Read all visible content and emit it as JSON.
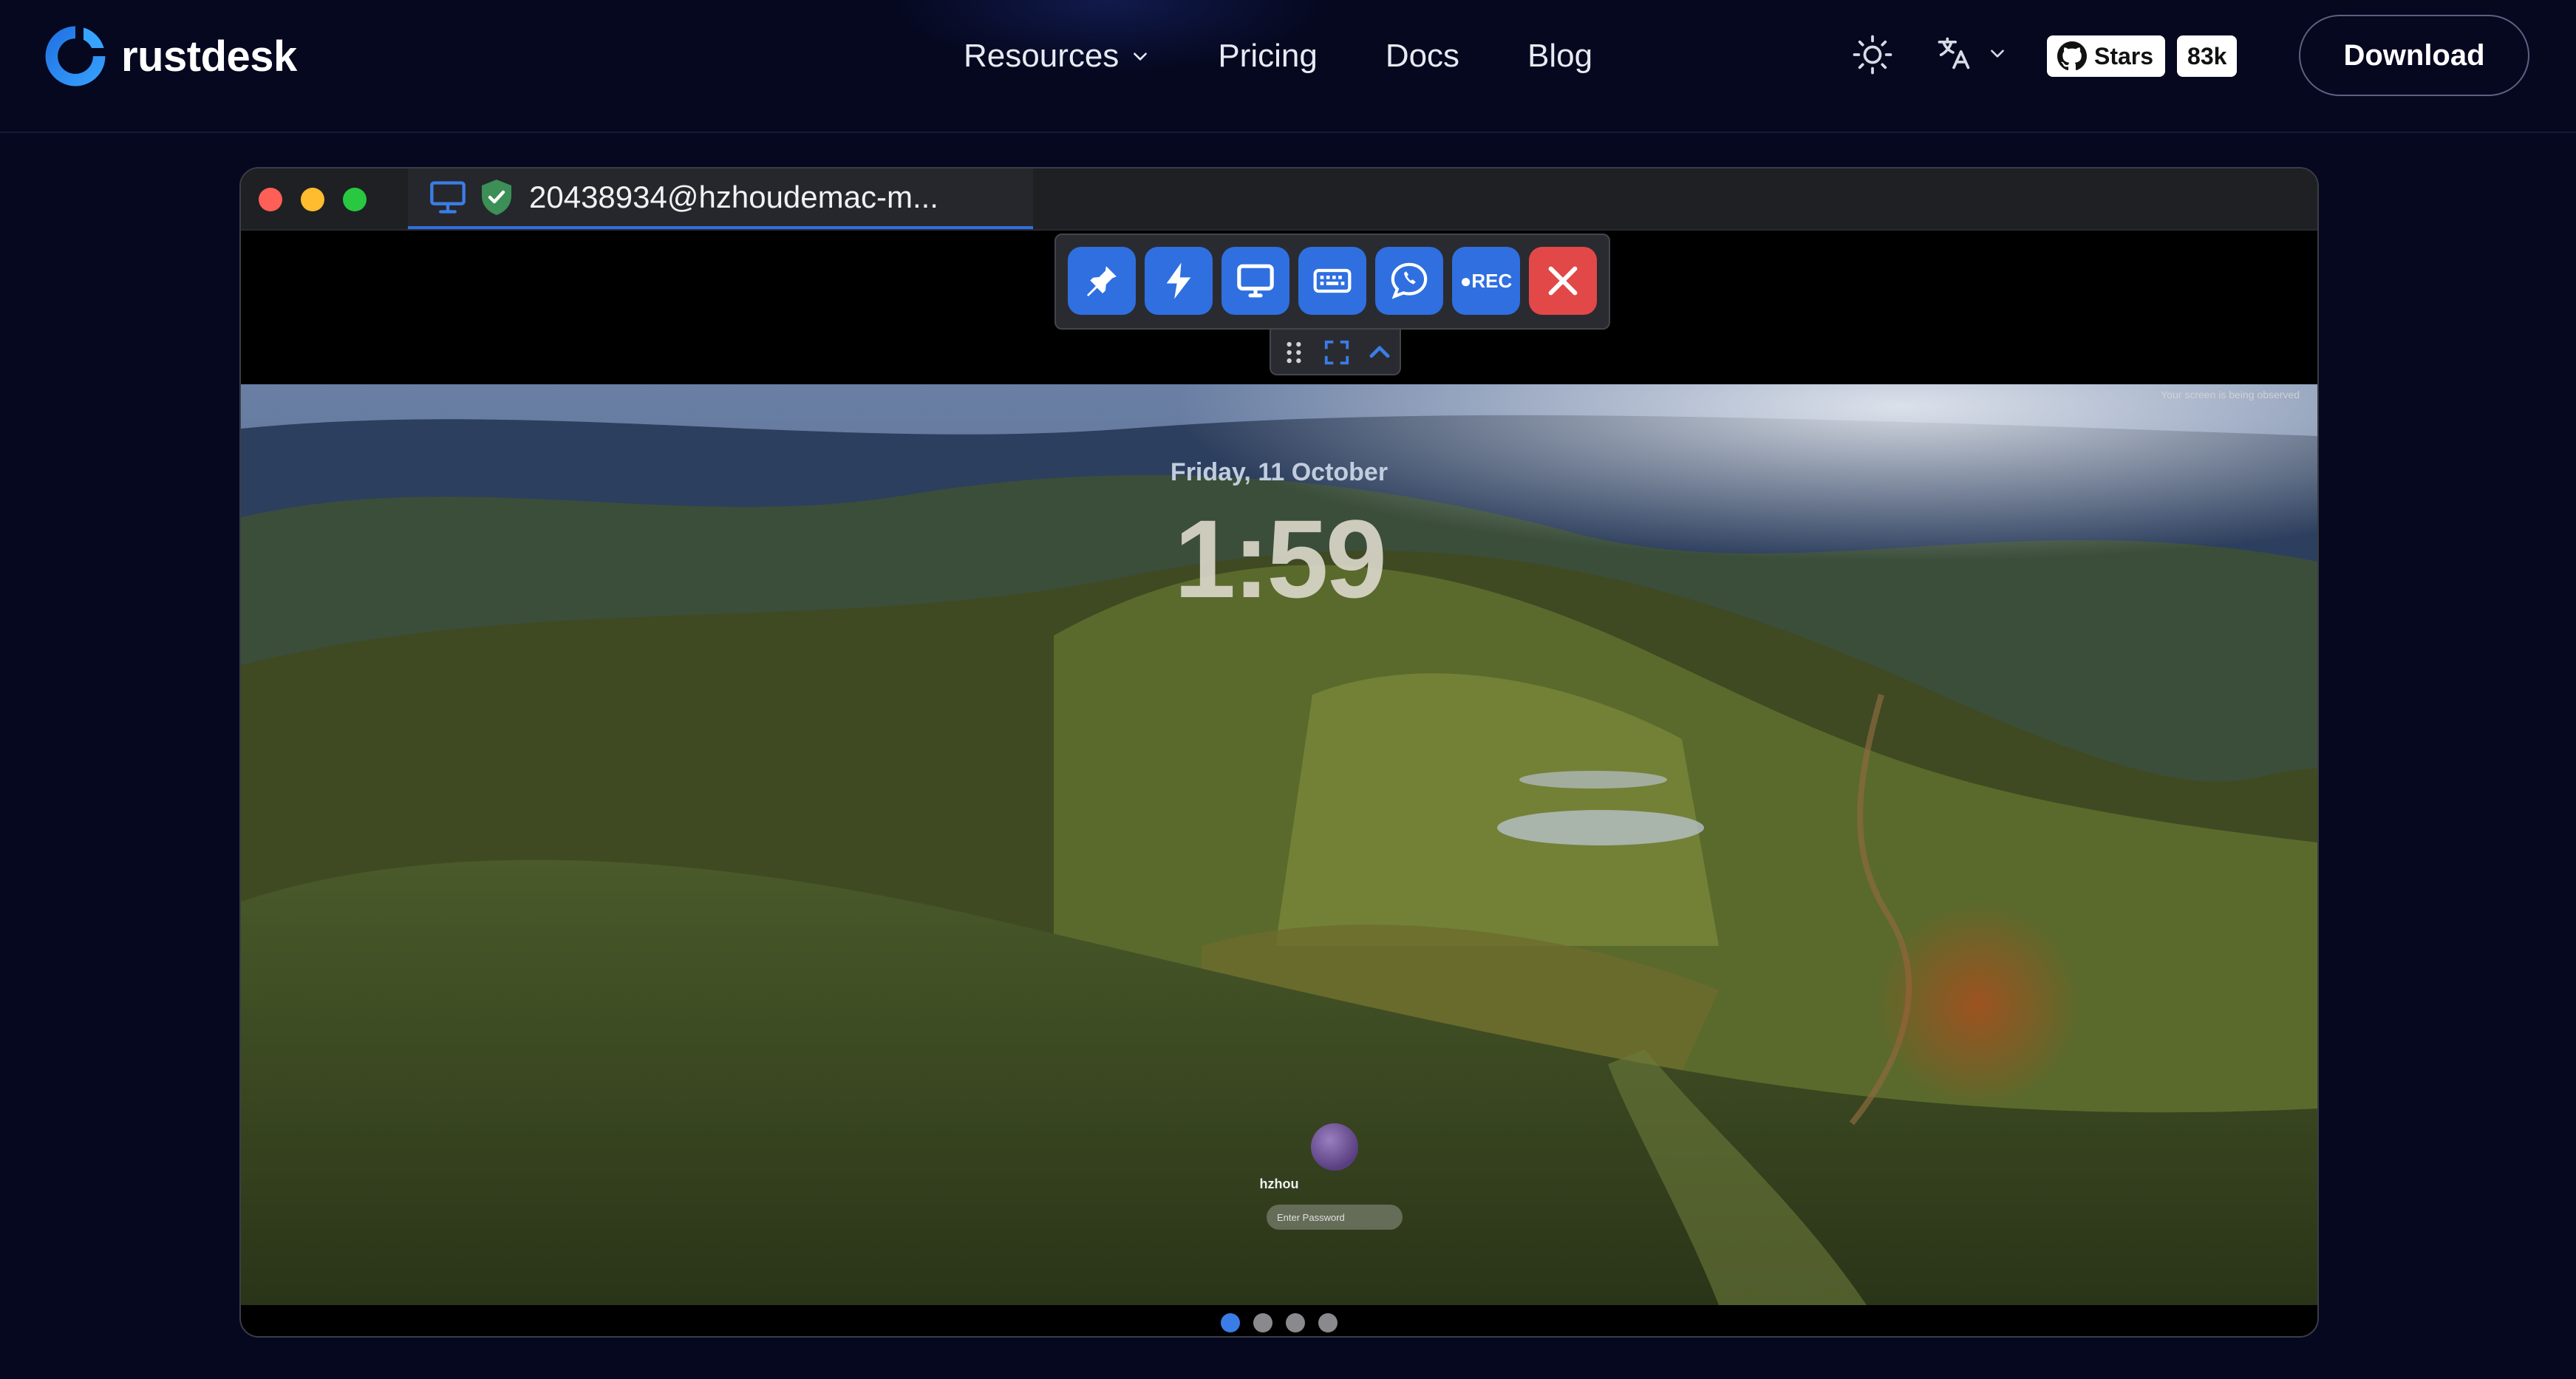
{
  "header": {
    "brand": "rustdesk",
    "nav": [
      {
        "label": "Resources",
        "has_dropdown": true
      },
      {
        "label": "Pricing"
      },
      {
        "label": "Docs"
      },
      {
        "label": "Blog"
      }
    ],
    "github_stars_label": "Stars",
    "github_stars_count": "83k",
    "download_label": "Download",
    "icons": [
      "sun-icon",
      "translate-icon",
      "chevron-down-icon",
      "github-icon"
    ]
  },
  "window": {
    "tab_title": "20438934@hzhoudemac-m...",
    "toolbar": {
      "buttons": [
        "pin",
        "action",
        "display",
        "keyboard",
        "chat",
        "record",
        "close"
      ],
      "rec_label": "●REC"
    }
  },
  "remote": {
    "observed_notice": "Your screen is being observed",
    "date": "Friday, 11 October",
    "time": "1:59",
    "username": "hzhou",
    "password_placeholder": "Enter Password"
  },
  "pager": {
    "count": 4,
    "active_index": 0
  },
  "colors": {
    "background": "#05081f",
    "accent": "#2f6fe0",
    "close_red": "#e24848"
  }
}
